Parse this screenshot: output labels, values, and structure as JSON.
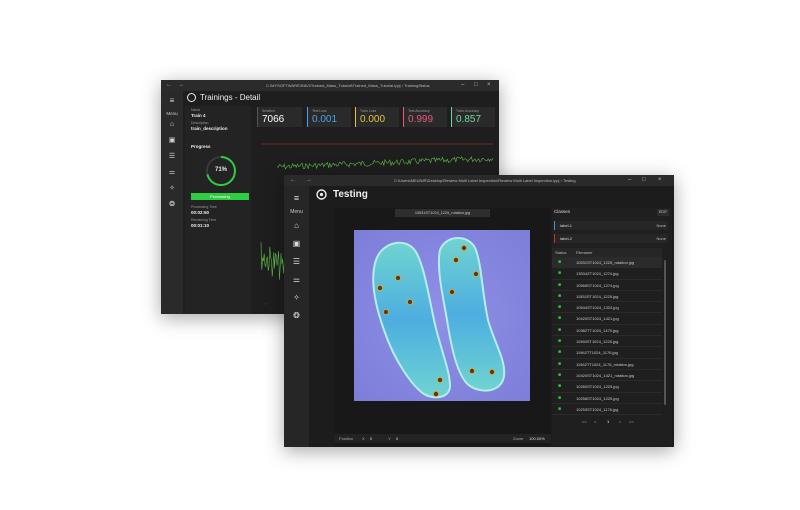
{
  "back_window": {
    "path": "C:\\MYSOFTWARE\\RAVI\\Trained_Mass_Tutorial\\Trained_Mass_Tutorial.ippj  ›  TrainingStatus",
    "title": "Trainings - Detail",
    "menu_label": "Menu",
    "name_label": "Name",
    "name_value": "Train 4",
    "description_label": "Description",
    "description_value": "train_description",
    "progress_label": "Progress",
    "progress_percent": 71,
    "progress_text": "71%",
    "status_button": "Processing",
    "processing_time_label": "Processing Time",
    "processing_time_value": "00:02:50",
    "remaining_time_label": "Remaining Time",
    "remaining_time_value": "00:01:10",
    "stats": [
      {
        "label": "Iteration",
        "value": "7066",
        "color": "#ffffff"
      },
      {
        "label": "Test Loss",
        "value": "0.001",
        "color": "#4aa3e8"
      },
      {
        "label": "Train Loss",
        "value": "0.000",
        "color": "#e8c23a"
      },
      {
        "label": "Test Accuracy",
        "value": "0.999",
        "color": "#e85a7c"
      },
      {
        "label": "Train Accuracy",
        "value": "0.857",
        "color": "#6fd6a0"
      }
    ]
  },
  "front_window": {
    "path": "C:\\Users\\MEUNIR\\Desktop\\Rewiew Multi Label Inspection\\Rewiew Multi Label Inspection.ippj  ›  Testing",
    "title": "Testing",
    "menu_label": "Menu",
    "image_filename": "10531ST1024_1225_rotation.jpg",
    "classes_label": "Classes",
    "edit_label": "EDIT",
    "classes": [
      {
        "name": "label-1",
        "value": "None",
        "color": "#4a90d9"
      },
      {
        "name": "label-2",
        "value": "None",
        "color": "#c0392b"
      }
    ],
    "table_headers": {
      "status": "Status",
      "filename": "Filename"
    },
    "files": [
      "10531ST1024_1225_rotation.jpg",
      "13534ZT1024_1274.jpg",
      "10565ST1024_1274.jpg",
      "11552ST1024_1225.jpg",
      "10544ST1024_1323.jpg",
      "10420ST1024_1421.jpg",
      "10382TT1024_1470.jpg",
      "11960ST1024_1225.jpg",
      "11962TT1024_1176.jpg",
      "11962TT1024_1176_rotation.jpg",
      "10420ST1024_1421_rotation.jpg",
      "10260ST1024_1225.jpg",
      "10258ST1024_1225.jpg",
      "10253ST1024_1176.jpg"
    ],
    "pagination": {
      "first": "<<",
      "prev": "<",
      "page": "1",
      "next": ">",
      "last": ">>"
    },
    "position_label": "Position",
    "x_label": "X",
    "x_value": "0",
    "y_label": "Y",
    "y_value": "0",
    "zoom_label": "Zoom",
    "zoom_value": "100.00%",
    "status_color": "#2ecc40"
  }
}
